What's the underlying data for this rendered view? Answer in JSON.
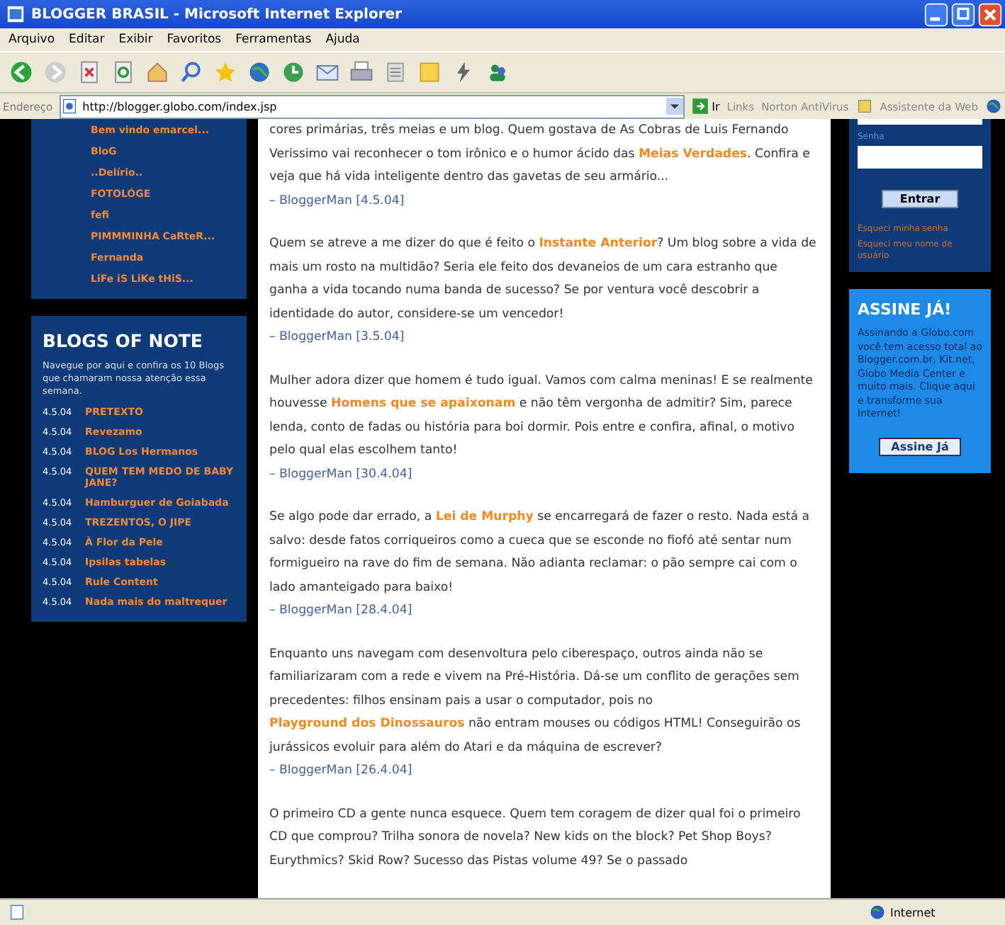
{
  "window": {
    "title": "BLOGGER BRASIL - Microsoft Internet Explorer"
  },
  "menu": [
    "Arquivo",
    "Editar",
    "Exibir",
    "Favoritos",
    "Ferramentas",
    "Ajuda"
  ],
  "address_bar": {
    "label": "Endereço",
    "url": "http://blogger.globo.com/index.jsp",
    "go": "Ir"
  },
  "links_bar": [
    "Links",
    "Norton AntiVirus",
    "Assistente da Web"
  ],
  "sidebar": {
    "recent_blogs": [
      "Bem vindo emarcel...",
      "BloG",
      "..Delírio..",
      "FOTOLÓGE",
      "fefi",
      "PIMMMINHA CaRteR...",
      "Fernanda",
      "LiFe iS LiKe tHiS..."
    ],
    "blogs_of_note": {
      "title": "BLOGS OF NOTE",
      "description": "Navegue por aqui e confira os 10 Blogs que chamaram nossa atenção essa semana.",
      "items": [
        {
          "date": "4.5.04",
          "name": "PRETEXTO"
        },
        {
          "date": "4.5.04",
          "name": "Revezamo"
        },
        {
          "date": "4.5.04",
          "name": "BLOG Los Hermanos"
        },
        {
          "date": "4.5.04",
          "name": "QUEM TEM MEDO DE BABY JANE?"
        },
        {
          "date": "4.5.04",
          "name": "Hamburguer de Goiabada"
        },
        {
          "date": "4.5.04",
          "name": "TREZENTOS, O JIPE"
        },
        {
          "date": "4.5.04",
          "name": "À Flor da Pele"
        },
        {
          "date": "4.5.04",
          "name": "Ipsilas tabelas"
        },
        {
          "date": "4.5.04",
          "name": "Rule Content"
        },
        {
          "date": "4.5.04",
          "name": "Nada mais do maltrequer"
        }
      ]
    }
  },
  "posts": [
    {
      "before": "cores primárias, três meias e um blog. Quem gostava de As Cobras de Luis Fernando Verissimo vai reconhecer o tom irônico e o humor ácido das ",
      "link": "Meias Verdades",
      "after": ". Confira e veja que há vida inteligente dentro das gavetas de seu armário...",
      "author": "– BloggerMan [4.5.04]"
    },
    {
      "before": "Quem se atreve a me dizer do que é feito o ",
      "link": "Instante Anterior",
      "after": "? Um blog sobre a vida de mais um rosto na multidão? Seria ele feito dos devaneios de um cara estranho que ganha a vida tocando numa banda de sucesso? Se por ventura você descobrir a identidade do autor, considere-se um vencedor!",
      "author": "– BloggerMan [3.5.04]"
    },
    {
      "before": "Mulher adora dizer que homem é tudo igual. Vamos com calma meninas! E se realmente houvesse ",
      "link": "Homens que se apaixonam",
      "after": " e não têm vergonha de admitir? Sim, parece lenda, conto de fadas ou história para boi dormir. Pois entre e confira, afinal, o motivo pelo qual elas escolhem tanto!",
      "author": "– BloggerMan [30.4.04]"
    },
    {
      "before": "Se algo pode dar errado, a ",
      "link": "Lei de Murphy",
      "after": " se encarregará de fazer o resto. Nada está a salvo: desde fatos corriqueiros como a cueca que se esconde no fiofó até sentar num formigueiro na rave do fim de semana. Não adianta reclamar: o pão sempre cai com o lado amanteigado para baixo!",
      "author": "– BloggerMan [28.4.04]"
    },
    {
      "before": "Enquanto uns navegam com desenvoltura pelo ciberespaço, outros ainda não se familiarizaram com a rede e vivem na Pré-História. Dá-se um conflito de gerações sem precedentes: filhos ensinam pais a usar o computador, pois no ",
      "link": "Playground dos Dinossauros",
      "after": " não entram mouses ou códigos HTML! Conseguirão os jurássicos evoluir para além do Atari e da máquina de escrever?",
      "author": "– BloggerMan [26.4.04]"
    },
    {
      "before": "O primeiro CD a gente nunca esquece. Quem tem coragem de dizer qual foi o primeiro CD que comprou? Trilha sonora de novela? New kids on the block? Pet Shop Boys? Eurythmics? Skid Row? Sucesso das Pistas volume 49? Se o passado"
    }
  ],
  "login": {
    "password_label": "Senha",
    "button": "Entrar",
    "links": [
      "Esqueci minha senha",
      "Esqueci meu nome de usuário"
    ]
  },
  "subscribe": {
    "title": "ASSINE JÁ!",
    "text": "Assinando a Globo.com você tem acesso total ao Blogger.com.br, Kit.net, Globo Media Center e muito mais. Clique aqui e transforme sua Internet!",
    "button": "Assine Já"
  },
  "status_bar": {
    "zone": "Internet"
  }
}
